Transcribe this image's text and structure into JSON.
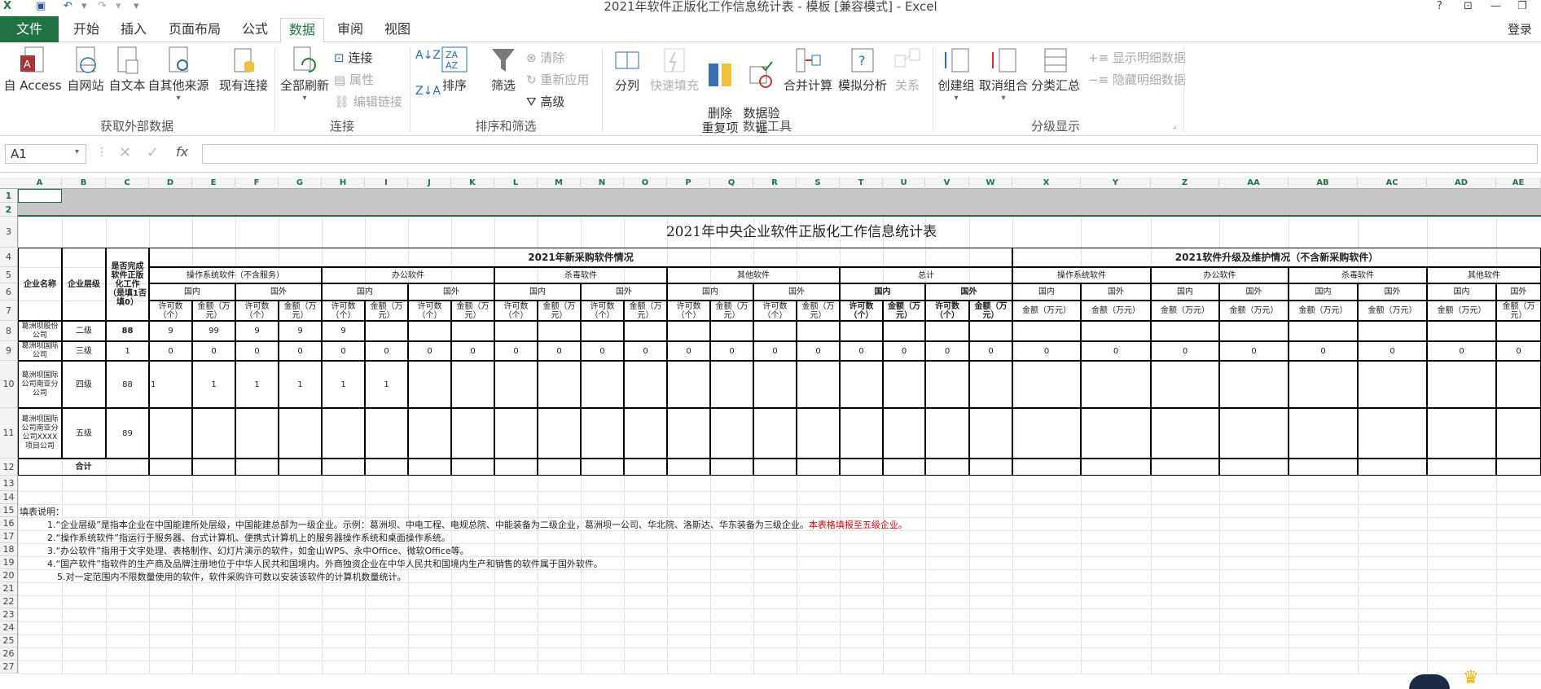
{
  "window": {
    "title": "2021年软件正版化工作信息统计表 - 模板  [兼容模式] - Excel",
    "login": "登录",
    "help": "?"
  },
  "tabs": [
    "文件",
    "开始",
    "插入",
    "页面布局",
    "公式",
    "数据",
    "审阅",
    "视图"
  ],
  "ribbon": {
    "groups": [
      {
        "label": "获取外部数据",
        "buttons": [
          "自 Access",
          "自网站",
          "自文本",
          "自其他来源",
          "现有连接"
        ]
      },
      {
        "label": "连接",
        "buttons": [
          "全部刷新"
        ],
        "small": [
          "连接",
          "属性",
          "编辑链接"
        ]
      },
      {
        "label": "排序和筛选",
        "buttons": [
          "排序",
          "筛选"
        ],
        "small": [
          "清除",
          "重新应用",
          "高级"
        ]
      },
      {
        "label": "数据工具",
        "buttons": [
          "分列",
          "快速填充",
          "删除\n重复项",
          "数据验\n证",
          "合并计算",
          "模拟分析",
          "关系"
        ]
      },
      {
        "label": "分级显示",
        "buttons": [
          "创建组",
          "取消组合",
          "分类汇总"
        ],
        "small": [
          "显示明细数据",
          "隐藏明细数据"
        ]
      }
    ]
  },
  "formula_bar": {
    "name_box": "A1",
    "fx": "fx"
  },
  "columns": [
    "A",
    "B",
    "C",
    "D",
    "E",
    "F",
    "G",
    "H",
    "I",
    "J",
    "K",
    "L",
    "M",
    "N",
    "O",
    "P",
    "Q",
    "R",
    "S",
    "T",
    "U",
    "V",
    "W",
    "X",
    "Y",
    "Z",
    "AA",
    "AB",
    "AC",
    "AD",
    "AE"
  ],
  "rows": [
    "1",
    "2",
    "3",
    "4",
    "5",
    "6",
    "7",
    "8",
    "9",
    "10",
    "11",
    "12",
    "13",
    "14",
    "15",
    "16",
    "17",
    "18",
    "19",
    "20",
    "21",
    "22",
    "23",
    "24",
    "25",
    "26",
    "27"
  ],
  "sheet": {
    "title": "2021年中央企业软件正版化工作信息统计表",
    "h_company": "企业名称",
    "h_level": "企业层级",
    "h_done": "是否完成软件正版化工作（是填1否填0）",
    "h_new": "2021年新采购软件情况",
    "h_upgrade": "2021软件升级及维护情况（不含新采购软件）",
    "cat": [
      "操作系统软件（不含服务）",
      "办公软件",
      "杀毒软件",
      "其他软件",
      "总计"
    ],
    "cat2": [
      "操作系统软件",
      "办公软件",
      "杀毒软件",
      "其他软件"
    ],
    "dom": "国内",
    "for": "国外",
    "lic": "许可数（个）",
    "amt": "金额（万元）",
    "r8": {
      "name": "葛洲坝股份公司",
      "level": "二级",
      "done": "88",
      "vals": [
        "9",
        "99",
        "9",
        "9",
        "9"
      ]
    },
    "r9": {
      "name": "葛洲坝国际公司",
      "level": "三级",
      "done": "1"
    },
    "r10": {
      "name": "葛洲坝国际公司南亚分公司",
      "level": "四级",
      "done": "88",
      "vals": [
        "1",
        "1",
        "1",
        "1",
        "1",
        "1"
      ]
    },
    "r11": {
      "name": "葛洲坝国际公司南亚分公司XXXX项目公司",
      "level": "五级",
      "done": "89"
    },
    "r12": "合计",
    "zero": "0",
    "notes": {
      "title": "填表说明：",
      "n1": "1.“企业层级”是指本企业在中国能建所处层级，中国能建总部为一级企业。示例：葛洲坝、中电工程、电规总院、中能装备为二级企业，葛洲坝一公司、华北院、洛斯达、华东装备为三级企业。",
      "n1r": "本表格填报至五级企业。",
      "n2": "2.“操作系统软件”指运行于服务器、台式计算机、便携式计算机上的服务器操作系统和桌面操作系统。",
      "n3": "3.“办公软件”指用于文字处理、表格制作、幻灯片演示的软件，如金山WPS、永中Office、微软Office等。",
      "n4": "4.“国产软件”指软件的生产商及品牌注册地位于中华人民共和国境内。外商独资企业在中华人民共和国境内生产和销售的软件属于国外软件。",
      "n5": "5.对一定范围内不限数量使用的软件，软件采购许可数以安装该软件的计算机数量统计。"
    }
  }
}
